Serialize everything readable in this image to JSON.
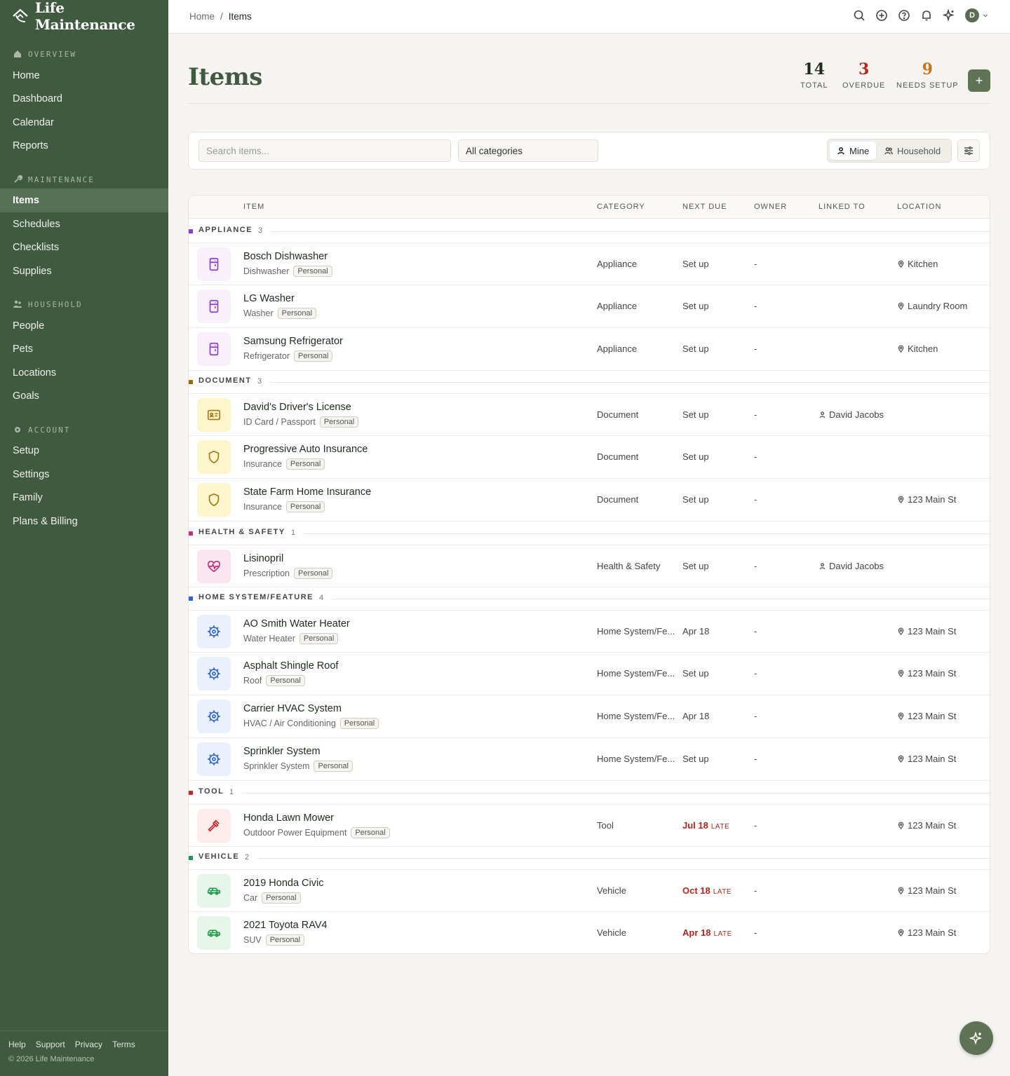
{
  "app": {
    "name": "Life Maintenance"
  },
  "sidebar": {
    "sections": [
      {
        "title": "OVERVIEW",
        "items": [
          "Home",
          "Dashboard",
          "Calendar",
          "Reports"
        ]
      },
      {
        "title": "MAINTENANCE",
        "items": [
          "Items",
          "Schedules",
          "Checklists",
          "Supplies"
        ]
      },
      {
        "title": "HOUSEHOLD",
        "items": [
          "People",
          "Pets",
          "Locations",
          "Goals"
        ]
      },
      {
        "title": "ACCOUNT",
        "items": [
          "Setup",
          "Settings",
          "Family",
          "Plans & Billing"
        ]
      }
    ],
    "active": "Items",
    "footer": {
      "links": [
        "Help",
        "Support",
        "Privacy",
        "Terms"
      ],
      "copyright": "© 2026 Life Maintenance"
    }
  },
  "topbar": {
    "breadcrumb": [
      "Home",
      "Items"
    ],
    "avatar": "D"
  },
  "page": {
    "title": "Items"
  },
  "stats": [
    {
      "value": "14",
      "label": "TOTAL",
      "color": "#1f2a1f"
    },
    {
      "value": "3",
      "label": "OVERDUE",
      "color": "#b3261e"
    },
    {
      "value": "9",
      "label": "NEEDS SETUP",
      "color": "#c8741a"
    }
  ],
  "filters": {
    "search_placeholder": "Search items...",
    "category": "All categories",
    "toggle": [
      "Mine",
      "Household"
    ],
    "toggle_active": "Mine"
  },
  "table": {
    "columns": [
      "ITEM",
      "CATEGORY",
      "NEXT DUE",
      "OWNER",
      "LINKED TO",
      "LOCATION"
    ],
    "groups": [
      {
        "name": "APPLIANCE",
        "count": "3",
        "color": "#8a3fd1",
        "icon": "appliance-icon",
        "bg": "#faf0fb",
        "stroke": "#8a3fd1",
        "rows": [
          {
            "name": "Bosch Dishwasher",
            "type": "Dishwasher",
            "badge": "Personal",
            "category": "Appliance",
            "due": "Set up",
            "late": "",
            "owner": "-",
            "linked": "",
            "location": "Kitchen"
          },
          {
            "name": "LG Washer",
            "type": "Washer",
            "badge": "Personal",
            "category": "Appliance",
            "due": "Set up",
            "late": "",
            "owner": "-",
            "linked": "",
            "location": "Laundry Room"
          },
          {
            "name": "Samsung Refrigerator",
            "type": "Refrigerator",
            "badge": "Personal",
            "category": "Appliance",
            "due": "Set up",
            "late": "",
            "owner": "-",
            "linked": "",
            "location": "Kitchen"
          }
        ]
      },
      {
        "name": "DOCUMENT",
        "count": "3",
        "color": "#9a6a0c",
        "icon": "id-card-icon",
        "bg": "#fdf6cc",
        "stroke": "#a5770e",
        "rows": [
          {
            "name": "David's Driver's License",
            "type": "ID Card / Passport",
            "badge": "Personal",
            "category": "Document",
            "due": "Set up",
            "late": "",
            "owner": "-",
            "linked": "David Jacobs",
            "location": "",
            "icon": "id-card-icon"
          },
          {
            "name": "Progressive Auto Insurance",
            "type": "Insurance",
            "badge": "Personal",
            "category": "Document",
            "due": "Set up",
            "late": "",
            "owner": "-",
            "linked": "",
            "location": "",
            "icon": "shield-icon"
          },
          {
            "name": "State Farm Home Insurance",
            "type": "Insurance",
            "badge": "Personal",
            "category": "Document",
            "due": "Set up",
            "late": "",
            "owner": "-",
            "linked": "",
            "location": "123 Main St",
            "icon": "shield-icon"
          }
        ]
      },
      {
        "name": "HEALTH & SAFETY",
        "count": "1",
        "color": "#c2317e",
        "icon": "heart-pulse-icon",
        "bg": "#fbe6ef",
        "stroke": "#c2317e",
        "rows": [
          {
            "name": "Lisinopril",
            "type": "Prescription",
            "badge": "Personal",
            "category": "Health & Safety",
            "due": "Set up",
            "late": "",
            "owner": "-",
            "linked": "David Jacobs",
            "location": ""
          }
        ]
      },
      {
        "name": "HOME SYSTEM/FEATURE",
        "count": "4",
        "color": "#2b63d9",
        "icon": "gear-icon",
        "bg": "#eaf1fd",
        "stroke": "#2b63d9",
        "rows": [
          {
            "name": "AO Smith Water Heater",
            "type": "Water Heater",
            "badge": "Personal",
            "category": "Home System/Fe...",
            "due": "Apr 18",
            "late": "",
            "owner": "-",
            "linked": "",
            "location": "123 Main St"
          },
          {
            "name": "Asphalt Shingle Roof",
            "type": "Roof",
            "badge": "Personal",
            "category": "Home System/Fe...",
            "due": "Set up",
            "late": "",
            "owner": "-",
            "linked": "",
            "location": "123 Main St"
          },
          {
            "name": "Carrier HVAC System",
            "type": "HVAC / Air Conditioning",
            "badge": "Personal",
            "category": "Home System/Fe...",
            "due": "Apr 18",
            "late": "",
            "owner": "-",
            "linked": "",
            "location": "123 Main St"
          },
          {
            "name": "Sprinkler System",
            "type": "Sprinkler System",
            "badge": "Personal",
            "category": "Home System/Fe...",
            "due": "Set up",
            "late": "",
            "owner": "-",
            "linked": "",
            "location": "123 Main St"
          }
        ]
      },
      {
        "name": "TOOL",
        "count": "1",
        "color": "#c62828",
        "icon": "hammer-icon",
        "bg": "#fdeceb",
        "stroke": "#c62828",
        "rows": [
          {
            "name": "Honda Lawn Mower",
            "type": "Outdoor Power Equipment",
            "badge": "Personal",
            "category": "Tool",
            "due": "Jul 18",
            "late": "LATE",
            "owner": "-",
            "linked": "",
            "location": "123 Main St"
          }
        ]
      },
      {
        "name": "VEHICLE",
        "count": "2",
        "color": "#1f9a4a",
        "icon": "car-icon",
        "bg": "#e6f6ea",
        "stroke": "#1f9a4a",
        "rows": [
          {
            "name": "2019 Honda Civic",
            "type": "Car",
            "badge": "Personal",
            "category": "Vehicle",
            "due": "Oct 18",
            "late": "LATE",
            "owner": "-",
            "linked": "",
            "location": "123 Main St"
          },
          {
            "name": "2021 Toyota RAV4",
            "type": "SUV",
            "badge": "Personal",
            "category": "Vehicle",
            "due": "Apr 18",
            "late": "LATE",
            "owner": "-",
            "linked": "",
            "location": "123 Main St"
          }
        ]
      }
    ]
  }
}
